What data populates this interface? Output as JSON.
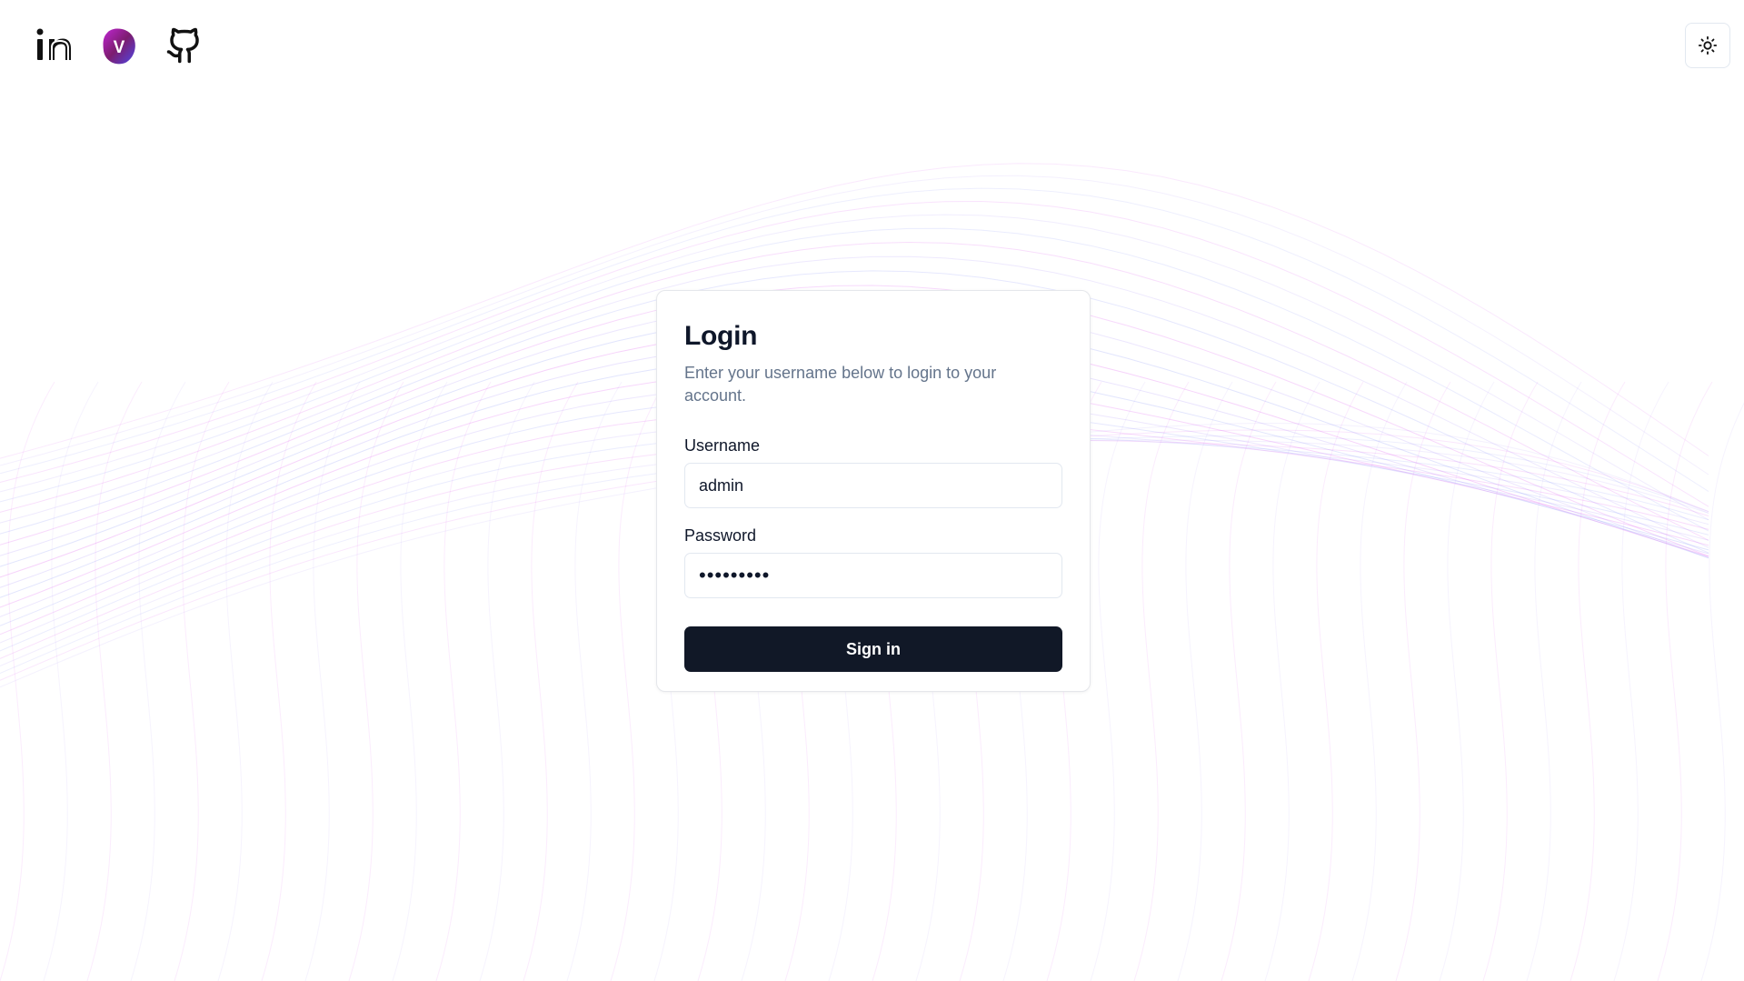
{
  "header": {
    "social_links": [
      {
        "icon": "linkedin-icon",
        "label": "LinkedIn"
      },
      {
        "icon": "v-logo-icon",
        "label": "V",
        "colors": [
          "#7c1d6f",
          "#c026d3",
          "#4f46e5"
        ]
      },
      {
        "icon": "github-icon",
        "label": "GitHub"
      }
    ],
    "theme_toggle_icon": "sun-icon"
  },
  "background": {
    "pattern": "wave-mesh",
    "colors": [
      "#d946ef",
      "#a78bfa",
      "#818cf8"
    ]
  },
  "login": {
    "title": "Login",
    "description": "Enter your username below to login to your account.",
    "username_label": "Username",
    "username_value": "admin",
    "password_label": "Password",
    "password_value": "•••••••••",
    "submit_label": "Sign in"
  },
  "colors": {
    "primary_button": "#111827",
    "text": "#0f172a",
    "muted": "#64748b",
    "border": "#e2e8f0"
  }
}
